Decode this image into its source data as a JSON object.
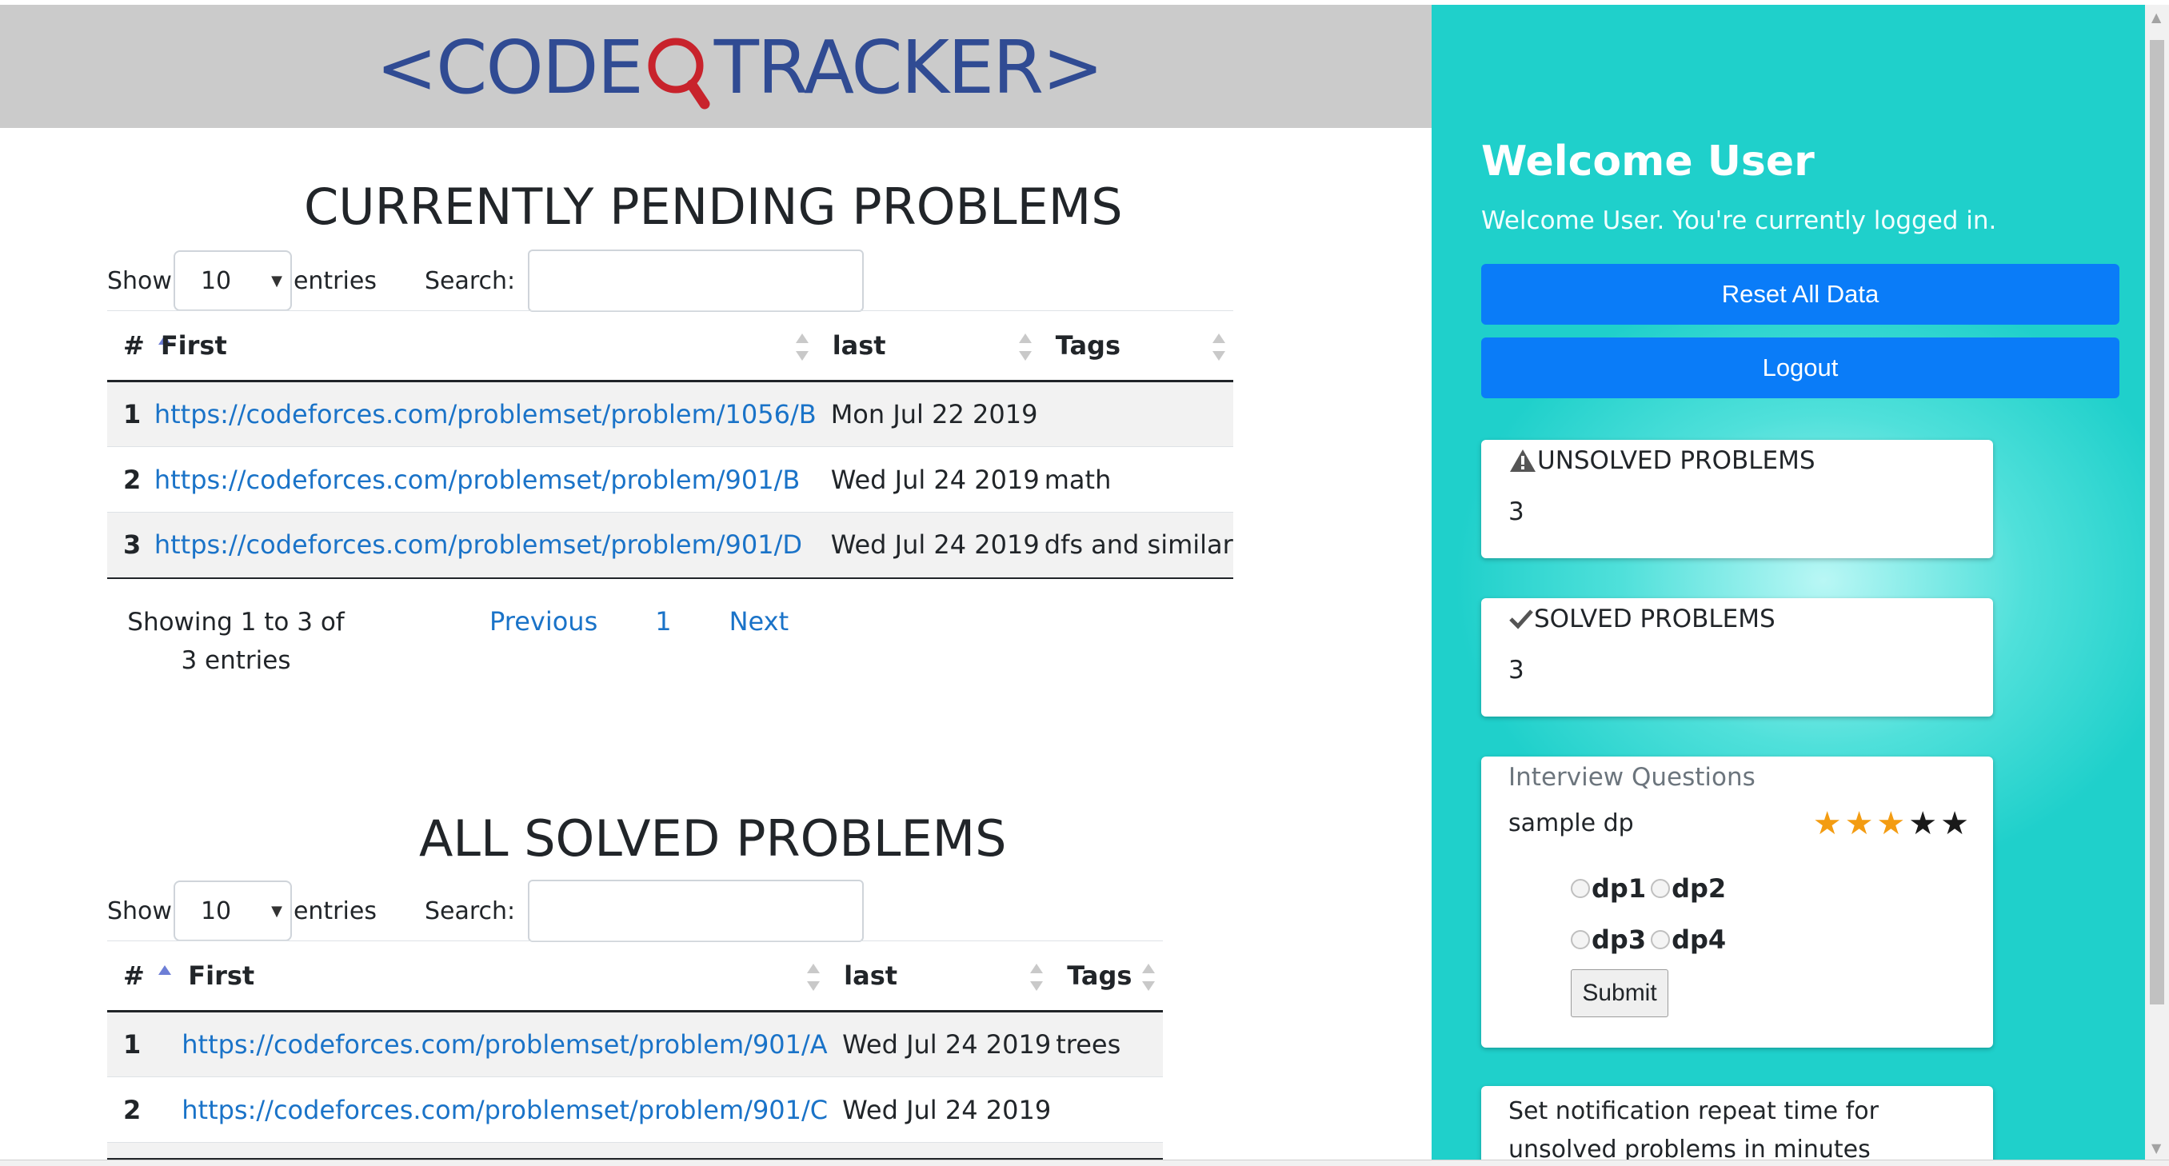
{
  "header": {
    "logo_prefix": "<CODE",
    "logo_suffix": "TRACKER>",
    "logo_color": "#304b93",
    "lens_color": "#c8232c"
  },
  "pending": {
    "title": "CURRENTLY PENDING PROBLEMS",
    "show_label": "Show",
    "entries_value": "10",
    "entries_label": "entries",
    "search_label": "Search:",
    "search_value": "",
    "columns": [
      "#",
      "First",
      "last",
      "Tags"
    ],
    "rows": [
      {
        "num": "1",
        "link": "https://codeforces.com/problemset/problem/1056/B",
        "date": "Mon Jul 22 2019",
        "tags": ""
      },
      {
        "num": "2",
        "link": "https://codeforces.com/problemset/problem/901/B",
        "date": "Wed Jul 24 2019",
        "tags": "math"
      },
      {
        "num": "3",
        "link": "https://codeforces.com/problemset/problem/901/D",
        "date": "Wed Jul 24 2019",
        "tags": "dfs and similar"
      }
    ],
    "info": "Showing 1 to 3 of 3 entries",
    "pager": {
      "previous": "Previous",
      "page": "1",
      "next": "Next"
    }
  },
  "solved": {
    "title": "ALL SOLVED PROBLEMS",
    "show_label": "Show",
    "entries_value": "10",
    "entries_label": "entries",
    "search_label": "Search:",
    "search_value": "",
    "columns": [
      "#",
      "First",
      "last",
      "Tags"
    ],
    "rows": [
      {
        "num": "1",
        "link": "https://codeforces.com/problemset/problem/901/A",
        "date": "Wed Jul 24 2019",
        "tags": "trees"
      },
      {
        "num": "2",
        "link": "https://codeforces.com/problemset/problem/901/C",
        "date": "Wed Jul 24 2019",
        "tags": ""
      }
    ]
  },
  "sidebar": {
    "welcome_title": "Welcome User",
    "welcome_sub": "Welcome User. You're currently logged in.",
    "reset_label": "Reset All Data",
    "logout_label": "Logout",
    "accent": "#1fd0cb",
    "button_color": "#0a7cf8",
    "unsolved": {
      "icon": "warning-icon",
      "label": "UNSOLVED PROBLEMS",
      "value": "3"
    },
    "solved": {
      "icon": "check-icon",
      "label": "SOLVED PROBLEMS",
      "value": "3"
    },
    "interview": {
      "title": "Interview Questions",
      "question": "sample dp",
      "rating": 3,
      "max_rating": 5,
      "options": [
        "dp1",
        "dp2",
        "dp3",
        "dp4"
      ],
      "submit_label": "Submit"
    },
    "notification_text": "Set notification repeat time for unsolved problems in minutes"
  }
}
